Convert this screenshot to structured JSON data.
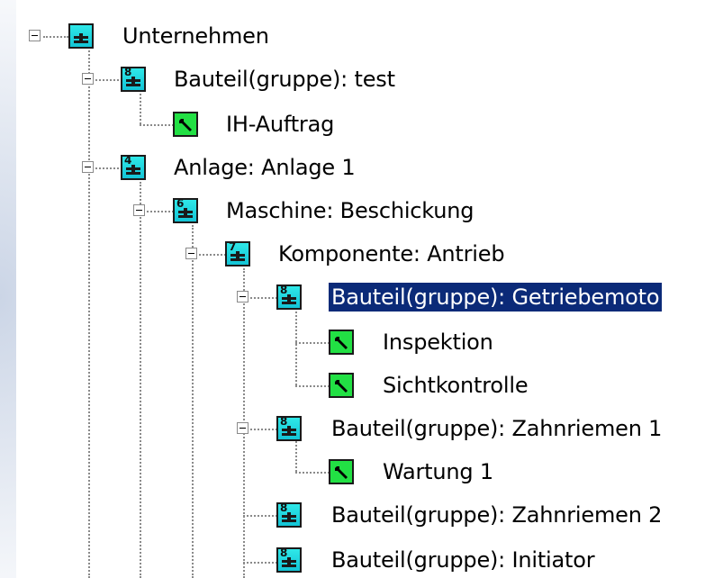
{
  "tree": {
    "items": [
      {
        "label": "Unternehmen",
        "icon": "machine-icon",
        "badge": ""
      },
      {
        "label": "Bauteil(gruppe): test",
        "icon": "machine-icon",
        "badge": "8"
      },
      {
        "label": "IH-Auftrag",
        "icon": "wrench-icon",
        "badge": ""
      },
      {
        "label": "Anlage: Anlage 1",
        "icon": "machine-icon",
        "badge": "4"
      },
      {
        "label": "Maschine: Beschickung",
        "icon": "machine-icon",
        "badge": "6"
      },
      {
        "label": "Komponente: Antrieb",
        "icon": "machine-icon",
        "badge": "7"
      },
      {
        "label": "Bauteil(gruppe): Getriebemoto",
        "icon": "machine-icon",
        "badge": "8",
        "selected": true
      },
      {
        "label": "Inspektion",
        "icon": "wrench-icon",
        "badge": ""
      },
      {
        "label": "Sichtkontrolle",
        "icon": "wrench-icon",
        "badge": ""
      },
      {
        "label": "Bauteil(gruppe): Zahnriemen 1",
        "icon": "machine-icon",
        "badge": "8"
      },
      {
        "label": "Wartung 1",
        "icon": "wrench-icon",
        "badge": ""
      },
      {
        "label": "Bauteil(gruppe): Zahnriemen 2",
        "icon": "machine-icon",
        "badge": "8"
      },
      {
        "label": "Bauteil(gruppe): Initiator",
        "icon": "machine-icon",
        "badge": "8"
      }
    ]
  },
  "colors": {
    "selection": "#0b2a78",
    "object_icon": "#2fe8e8",
    "task_icon": "#22e044"
  }
}
